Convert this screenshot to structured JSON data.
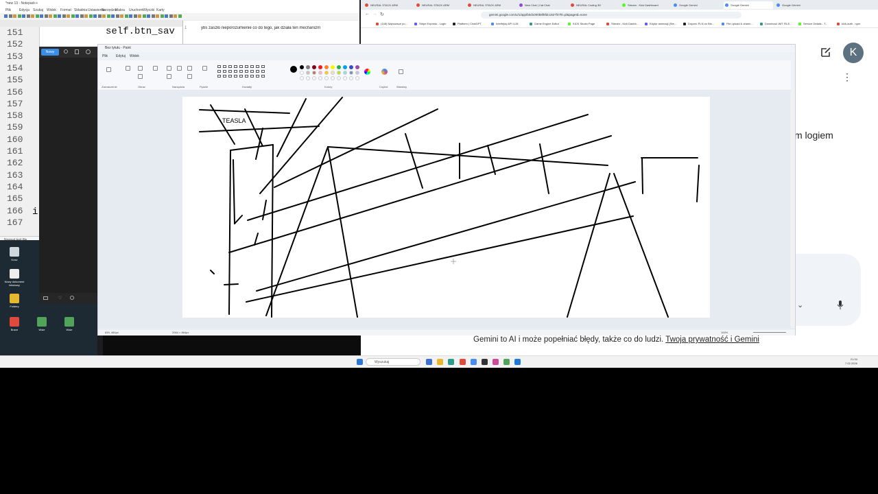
{
  "notepad": {
    "title": "*new 13 - Notepad++",
    "menu": [
      "Plik",
      "Edycja",
      "Szukaj",
      "Widok",
      "Format",
      "Składnia",
      "Ustawienia",
      "Narzędzia",
      "Makra",
      "Uruchom",
      "Wtyczki",
      "Karty"
    ],
    "line_numbers": [
      "151",
      "152",
      "153",
      "154",
      "155",
      "156",
      "157",
      "158",
      "159",
      "160",
      "161",
      "162",
      "163",
      "164",
      "165",
      "166",
      "167"
    ],
    "code_line": "self.btn_sav",
    "right_line_number": "1",
    "right_text": "ybs zaszło nieporozumienie co do tego, jak działa ten mechanizm",
    "status": "Normal text file"
  },
  "snip": {
    "new_label": "Nowy"
  },
  "desktop": {
    "icons": [
      "Kosz",
      "Nowy dokument tekstowy",
      "Foldery",
      "Brave",
      "Wsie",
      "Wsie"
    ]
  },
  "browser": {
    "tabs": [
      "NEURAL STACK ARM",
      "NEURAL STACK ARM",
      "NEURAL STACK ARM",
      "New Chat | Cat Chat",
      "NEURAL Coding 3D",
      "Stream - Kick Dashboard",
      "Google Gemini",
      "Google Gemini",
      "Google Gemini"
    ],
    "url": "gemini.google.com/u/1/app/b0d1000b8f8fdc1927f4?hl=pl&pageId=none",
    "bookmarks": [
      "(148) Najnowsze po...",
      "Stripe Express - Login",
      "Platform | ChatGPT",
      "Interfejsy API LLM",
      "Game Engine Editor",
      "KICK Studio Page",
      "Stream - Kick Dashb...",
      "Edytor animacji (Ste...",
      "Dojrzeć PLN on Bin...",
      "File upload & sharin...",
      "Download JMT FILE...",
      "Service Details - T...",
      "kick-auth - npm"
    ],
    "avatar_letter": "K",
    "partial_text": "m logiem",
    "disclaimer": "Gemini to AI i może popełniać błędy, także co do ludzi.",
    "privacy_link": "Twoja prywatność i Gemini"
  },
  "paint": {
    "title": "Bez tytułu - Paint",
    "menu": [
      "Plik",
      "Edytuj",
      "Widok"
    ],
    "groups": [
      "Zaznaczenie",
      "Obraz",
      "Narzędzia",
      "Pędzle",
      "Kształty",
      "Kolory",
      "Copilot",
      "Warstwy"
    ],
    "canvas_text": "TEASLA",
    "status_pos": "839, 484px",
    "status_size": "2064 × 864px",
    "zoom": "100%"
  },
  "taskbar": {
    "search_placeholder": "Wyszukaj",
    "time": "21:34",
    "date": "7.02.2026"
  },
  "colors": {
    "accent": "#3a8ee6",
    "avatar": "#5d7280"
  }
}
